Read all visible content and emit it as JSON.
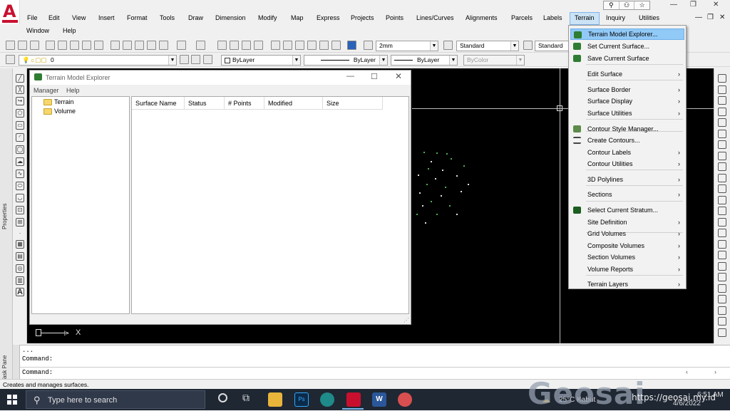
{
  "titlebar": {
    "search_icons": [
      "search-icon",
      "user-icon",
      "star-icon"
    ],
    "window_controls": [
      "—",
      "❐",
      "✕"
    ]
  },
  "menu": {
    "items": [
      "File",
      "Edit",
      "View",
      "Insert",
      "Format",
      "Tools",
      "Draw",
      "Dimension",
      "Modify",
      "Map",
      "Express",
      "Projects",
      "Points",
      "Lines/Curves",
      "Alignments",
      "Parcels",
      "Labels",
      "Terrain",
      "Inquiry",
      "Utilities"
    ],
    "row2": [
      "Window",
      "Help"
    ],
    "active": "Terrain",
    "mdi_controls": [
      "—",
      "❐",
      "✕"
    ]
  },
  "toolbar1": {
    "text_height": "2mm",
    "text_style": "Standard",
    "dim_style": "Standard"
  },
  "toolbar2": {
    "layer": "0",
    "color": "ByLayer",
    "linetype": "ByLayer",
    "lineweight": "ByLayer",
    "plotstyle": "ByColor"
  },
  "left_rail": {
    "properties": "Properties",
    "task_pane": "Task Pane"
  },
  "tme": {
    "title": "Terrain Model Explorer",
    "menu": [
      "Manager",
      "Help"
    ],
    "tree": [
      "Terrain",
      "Volume"
    ],
    "columns": [
      "Surface Name",
      "Status",
      "# Points",
      "Modified",
      "Size"
    ]
  },
  "ucs": {
    "x_label": "X"
  },
  "terrain_menu": {
    "items": [
      {
        "label": "Terrain Model Explorer...",
        "submenu": false,
        "icon": "terrain-explorer-icon"
      },
      {
        "label": "Set Current Surface...",
        "submenu": false,
        "icon": "set-surface-icon"
      },
      {
        "label": "Save Current Surface",
        "submenu": false,
        "icon": "save-surface-icon"
      },
      {
        "label": "Edit Surface",
        "submenu": true
      },
      {
        "label": "Surface Border",
        "submenu": true
      },
      {
        "label": "Surface Display",
        "submenu": true
      },
      {
        "label": "Surface Utilities",
        "submenu": true
      },
      {
        "label": "Contour Style Manager...",
        "submenu": false,
        "icon": "contour-style-icon"
      },
      {
        "label": "Create Contours...",
        "submenu": false,
        "icon": "create-contours-icon"
      },
      {
        "label": "Contour Labels",
        "submenu": true
      },
      {
        "label": "Contour Utilities",
        "submenu": true
      },
      {
        "label": "3D Polylines",
        "submenu": true
      },
      {
        "label": "Sections",
        "submenu": true
      },
      {
        "label": "Select Current Stratum...",
        "submenu": false,
        "icon": "stratum-icon"
      },
      {
        "label": "Site Definition",
        "submenu": true
      },
      {
        "label": "Grid Volumes",
        "submenu": true
      },
      {
        "label": "Composite Volumes",
        "submenu": true
      },
      {
        "label": "Section Volumes",
        "submenu": true
      },
      {
        "label": "Volume Reports",
        "submenu": true
      },
      {
        "label": "Terrain Layers",
        "submenu": true
      }
    ]
  },
  "command": {
    "line1": "...",
    "line2": "Command:",
    "line3": "Command:"
  },
  "status": {
    "text": "Creates and manages surfaces."
  },
  "taskbar": {
    "search_placeholder": "Type here to search",
    "weather": "25°C  Kabut",
    "time": "6:51 AM",
    "date": "4/6/2022"
  },
  "watermark": {
    "brand": "Geosai",
    "url": "https://geosai.my.id"
  },
  "colors": {
    "accent_red": "#c8102e",
    "canvas": "#000000",
    "menu_highlight": "#91c9f7",
    "taskbar": "#1f2733"
  }
}
